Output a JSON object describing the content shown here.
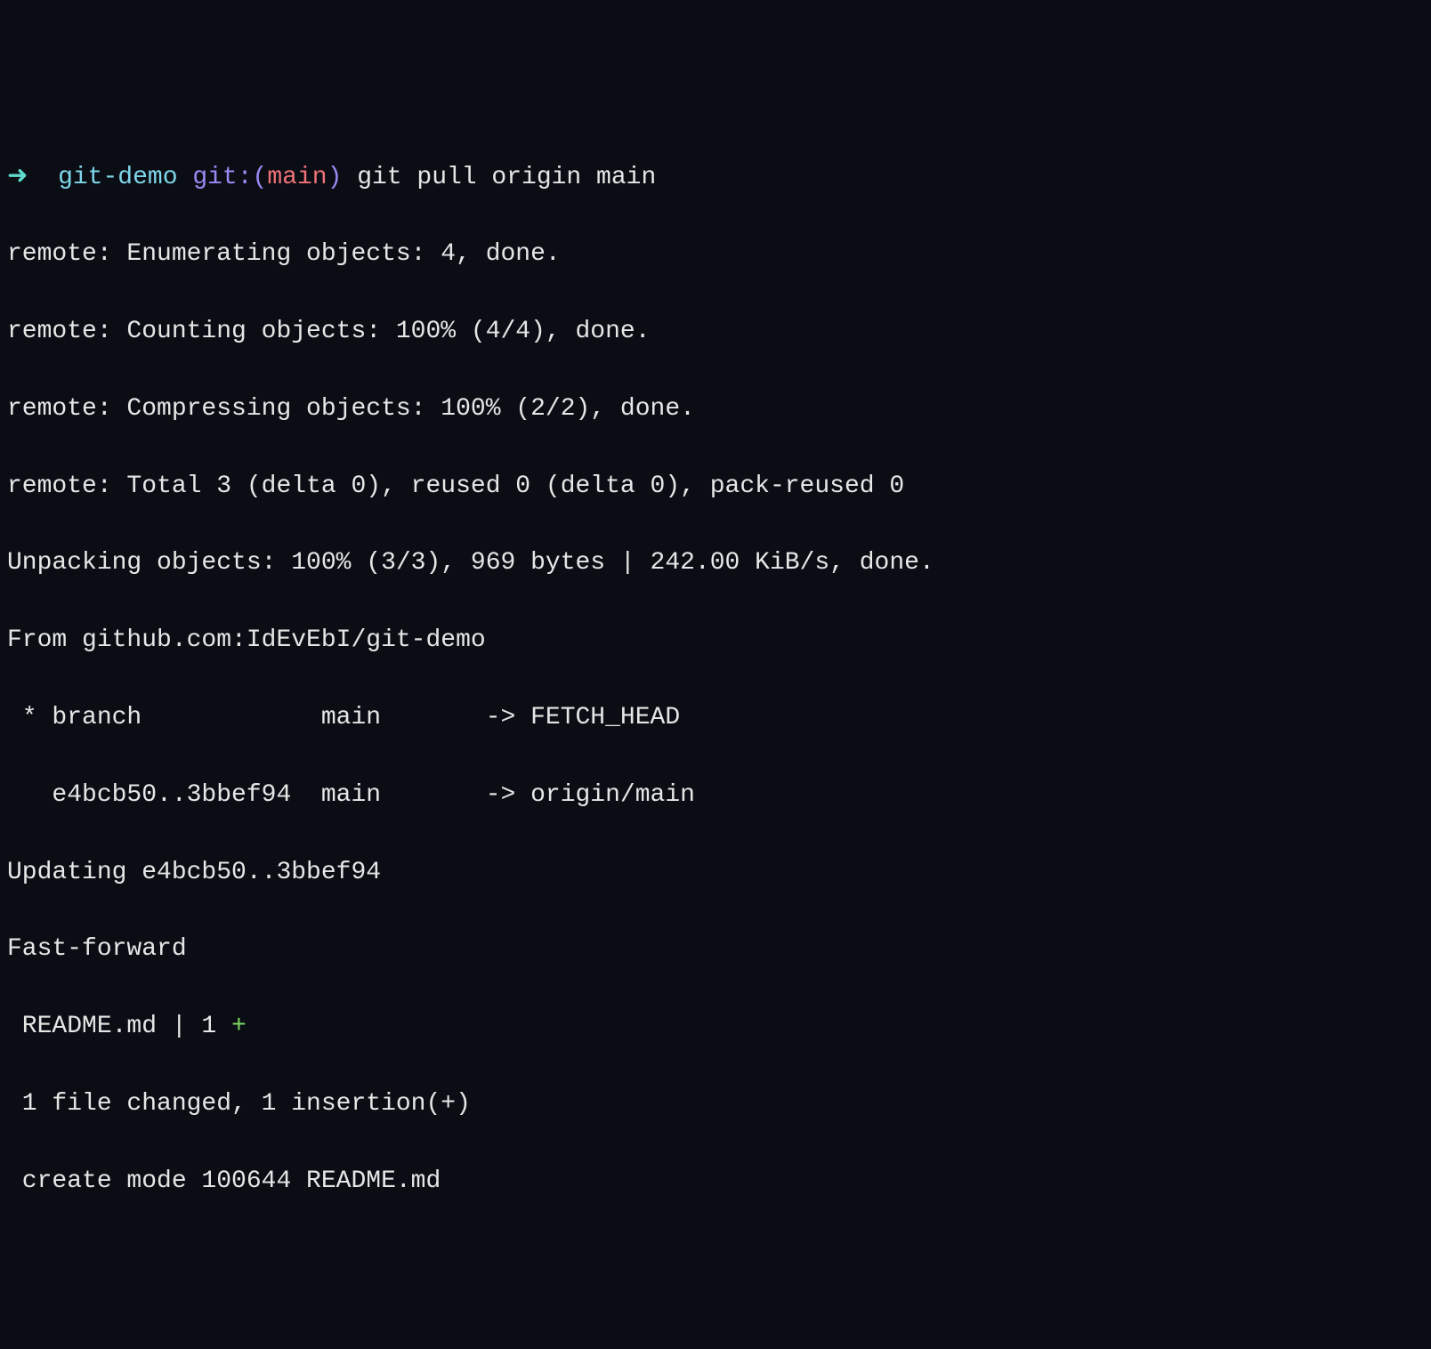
{
  "prompt": {
    "arrow": "➜",
    "directory": "git-demo",
    "git_label": "git:",
    "paren_open": "(",
    "branch": "main",
    "paren_close": ")",
    "command": "git pull origin main"
  },
  "output": {
    "line1": "remote: Enumerating objects: 4, done.",
    "line2": "remote: Counting objects: 100% (4/4), done.",
    "line3": "remote: Compressing objects: 100% (2/2), done.",
    "line4": "remote: Total 3 (delta 0), reused 0 (delta 0), pack-reused 0",
    "line5": "Unpacking objects: 100% (3/3), 969 bytes | 242.00 KiB/s, done.",
    "line6": "From github.com:IdEvEbI/git-demo",
    "line7": " * branch            main       -> FETCH_HEAD",
    "line8": "   e4bcb50..3bbef94  main       -> origin/main",
    "line9": "Updating e4bcb50..3bbef94",
    "line10": "Fast-forward",
    "line11_prefix": " README.md | 1 ",
    "line11_plus": "+",
    "line12": " 1 file changed, 1 insertion(+)",
    "line13": " create mode 100644 README.md"
  }
}
